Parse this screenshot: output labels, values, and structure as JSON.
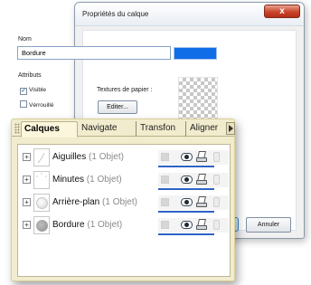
{
  "dialog": {
    "title": "Propriétés du calque",
    "close_label": "x",
    "name_label": "Nom",
    "name_value": "Bordure",
    "swatch_color": "#0f6de8",
    "attributes_label": "Attributs",
    "visible_label": "Visible",
    "visible_checked": "✓",
    "locked_label": "Vérrouillé",
    "textures_label": "Textures de papier :",
    "edit_button": "Editer...",
    "cancel_button": "Annuler"
  },
  "panel": {
    "tabs": [
      {
        "label": "Calques"
      },
      {
        "label": "Navigate"
      },
      {
        "label": "Transfon"
      },
      {
        "label": "Aligner"
      }
    ],
    "layers": [
      {
        "name": "Aiguilles",
        "count": "(1 Objet)",
        "thumb": "hands",
        "expand": "+"
      },
      {
        "name": "Minutes",
        "count": "(1 Objet)",
        "thumb": "dots",
        "expand": "+"
      },
      {
        "name": "Arrière-plan",
        "count": "(1 Objet)",
        "thumb": "light-circle",
        "expand": "+"
      },
      {
        "name": "Bordure",
        "count": "(1 Objet)",
        "thumb": "grey-circle",
        "expand": "+"
      }
    ]
  }
}
